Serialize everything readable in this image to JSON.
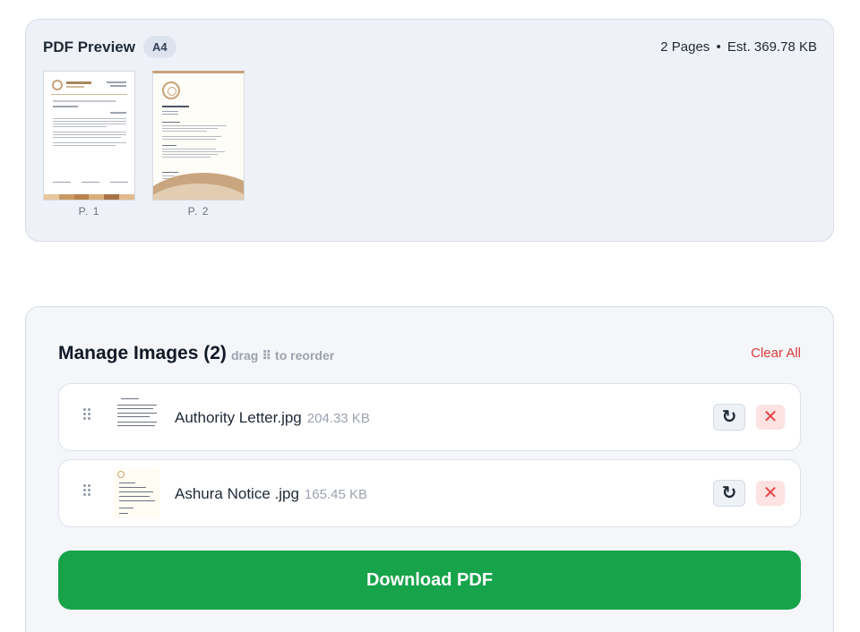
{
  "preview": {
    "title": "PDF Preview",
    "page_size": "A4",
    "page_count": "2 Pages",
    "separator": "•",
    "estimate": "Est. 369.78 KB",
    "pages": [
      {
        "label": "P. 1"
      },
      {
        "label": "P. 2"
      }
    ]
  },
  "manage": {
    "title": "Manage Images (2)",
    "hint": "drag ⠿ to reorder",
    "clear_all": "Clear All",
    "items": [
      {
        "name": "Authority Letter.jpg",
        "size": "204.33 KB",
        "rotate_icon": "↻",
        "remove_icon": "✕"
      },
      {
        "name": "Ashura Notice .jpg",
        "size": "165.45 KB",
        "rotate_icon": "↻",
        "remove_icon": "✕"
      }
    ]
  },
  "download": {
    "label": "Download PDF",
    "color": "#16a34a"
  },
  "colors": {
    "accent_green": "#16a34a",
    "danger_red": "#dc3b3b",
    "panel_bg": "#eef1f7"
  }
}
